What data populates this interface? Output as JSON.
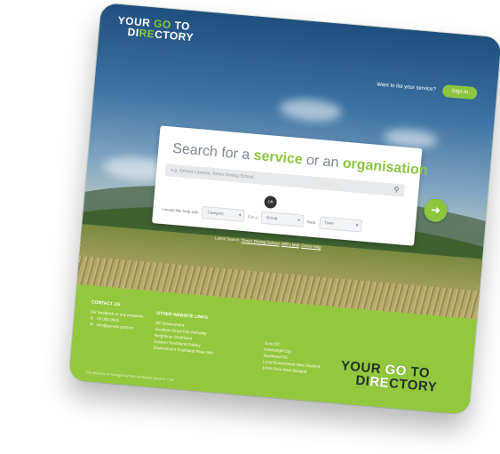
{
  "header": {
    "logo": {
      "line1_a": "YOUR ",
      "line1_b": "GO",
      "line1_c": " TO",
      "line2_a": "DI",
      "line2_b": "RE",
      "line2_c": "CTORY"
    },
    "list_service_link": "Want to list your service?",
    "sign_in_label": "Sign In"
  },
  "search": {
    "headline_a": "Search for a ",
    "headline_service": "service",
    "headline_b": " or an ",
    "headline_org": "organisation",
    "placeholder": "e.g. Drivers License, Tonys Driving School...",
    "toggle_label": "OR",
    "filter_prefix": "I would like help with",
    "category_value": "Category",
    "for_label": "For a",
    "group_value": "Group",
    "near_label": "Near",
    "town_value": "Town",
    "go_icon": "arrow-right-icon"
  },
  "latest": {
    "prefix": "Latest Search: ",
    "links": [
      "Tony's Driving School",
      "Will's Mall",
      "Cross Help"
    ]
  },
  "footer": {
    "contact": {
      "heading": "CONTACT US",
      "line": "For feedback or any enquiries",
      "phone": "03 000 0000",
      "email": "info@goredc.govt.nz"
    },
    "links": {
      "heading": "OTHER WEBSITE LINKS",
      "items": [
        "SE Government",
        "Southern Rural Fire Authority",
        "Neighbour Southland",
        "Eastern Southland Gallery",
        "Environment Southland River Info"
      ]
    },
    "col3": {
      "items": [
        "Gore DC",
        "Invercargill City",
        "Southland DC",
        "Local Government New Zealand",
        "100% Pure New Zealand"
      ]
    },
    "credit": "This directory is managed by the Community Services Trust"
  },
  "colors": {
    "accent": "#8cc63f"
  }
}
